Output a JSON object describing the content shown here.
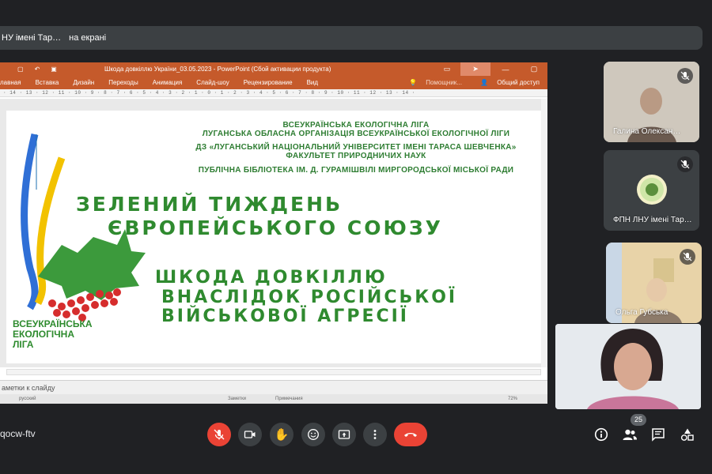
{
  "presenter_banner": {
    "name": "НУ імені Тар…",
    "label": "на екрані"
  },
  "powerpoint": {
    "window_title": "Шкода довкіллю України_03.05.2023 - PowerPoint (Сбой активации продукта)",
    "menu": [
      "лавная",
      "Вставка",
      "Дизайн",
      "Переходы",
      "Анимация",
      "Слайд-шоу",
      "Рецензирование",
      "Вид"
    ],
    "help": "Помощник...",
    "share_access": "Общий доступ",
    "ruler": "· 14 · 13 · 12 · 11 · 10 · 9 · 8 · 7 · 6 · 5 · 4 · 3 · 2 · 1 · 0 · 1 · 2 · 3 · 4 · 5 · 6 · 7 · 8 · 9 · 10 · 11 · 12 · 13 · 14 ·",
    "notes_placeholder": "аметки к слайду",
    "status": {
      "language": "русский",
      "notes": "Заметки",
      "comments": "Примечания",
      "zoom": "72%"
    }
  },
  "slide": {
    "org1": "ВСЕУКРАЇНСЬКА ЕКОЛОГІЧНА ЛІГА",
    "org2": "ЛУГАНСЬКА ОБЛАСНА ОРГАНІЗАЦІЯ ВСЕУКРАЇНСЬКОЇ ЕКОЛОГІЧНОЇ ЛІГИ",
    "org3": "ДЗ «ЛУГАНСЬКИЙ НАЦІОНАЛЬНИЙ УНІВЕРСИТЕТ ІМЕНІ ТАРАСА ШЕВЧЕНКА»",
    "org4": "ФАКУЛЬТЕТ ПРИРОДНИЧИХ НАУК",
    "org5": "ПУБЛІЧНА БІБЛІОТЕКА ІМ. Д. ГУРАМІШВІЛІ МИРГОРОДСЬКОЇ МІСЬКОЇ РАДИ",
    "title_line1": "ЗЕЛЕНИЙ ТИЖДЕНЬ",
    "title_line2": "ЄВРОПЕЙСЬКОГО СОЮЗУ",
    "sub_line1": "ШКОДА ДОВКІЛЛЮ",
    "sub_line2": "ВНАСЛІДОК РОСІЙСЬКОЇ",
    "sub_line3": "ВІЙСЬКОВОЇ АГРЕСІЇ",
    "logo_line1": "ВСЕУКРАЇНСЬКА",
    "logo_line2": "ЕКОЛОГІЧНА",
    "logo_line3": "ЛІГА"
  },
  "participants": [
    {
      "name": "Галина Олексан…",
      "muted": true
    },
    {
      "name": "ФПН ЛНУ імені Тар…",
      "muted": true
    },
    {
      "name": "Ольга Губська",
      "muted": true
    },
    {
      "name": "",
      "muted": false
    }
  ],
  "bottom_bar": {
    "meeting_code": "qocw-ftv",
    "participant_count": "25"
  },
  "colors": {
    "background": "#202124",
    "tile": "#3c4043",
    "danger": "#ea4335",
    "ppt_ribbon": "#c55a2b",
    "slide_green": "#2f8a2f"
  }
}
